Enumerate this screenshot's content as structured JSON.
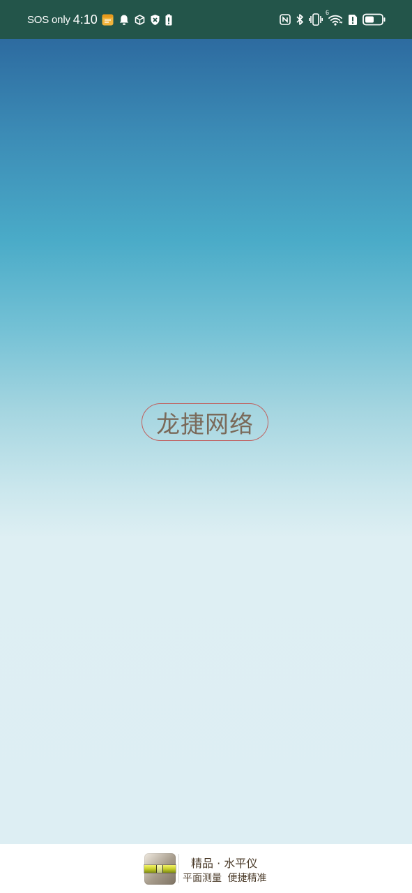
{
  "status_bar": {
    "carrier": "SOS only",
    "time": "4:10",
    "left_icons": [
      "calendar-notification-icon",
      "bell-icon",
      "box-icon",
      "shield-icon",
      "battery-alert-icon"
    ],
    "right_icons": [
      "nfc-icon",
      "bluetooth-icon",
      "vibrate-icon",
      "wifi-icon",
      "sim-alert-icon",
      "battery-icon"
    ],
    "wifi_badge": "6",
    "background": "#23554a"
  },
  "splash": {
    "brand_text": "龙捷网络",
    "brand_color": "#7a6a5a",
    "border_color": "#c0605e",
    "gradient_top": "#2d6ba0",
    "gradient_bottom": "#ddeef3"
  },
  "footer": {
    "app_icon": "spirit-level-icon",
    "title": "精品 · 水平仪",
    "subtitle": "平面测量  便捷精准"
  }
}
